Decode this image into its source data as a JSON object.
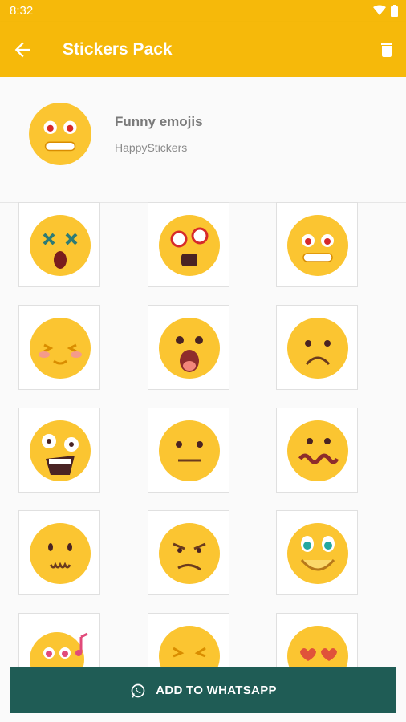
{
  "status": {
    "time": "8:32"
  },
  "appbar": {
    "title": "Stickers Pack"
  },
  "pack": {
    "name": "Funny emojis",
    "publisher": "HappyStickers"
  },
  "action": {
    "label": "ADD TO WHATSAPP"
  },
  "colors": {
    "accent": "#f6b90a",
    "cta": "#1f5c55",
    "emoji": "#fbc531"
  },
  "stickers": [
    "dizzy-face",
    "shocked-face",
    "angry-grimace",
    "blushing-face",
    "open-mouth-face",
    "frown-face",
    "screaming-face",
    "neutral-face",
    "confused-face",
    "cute-face",
    "annoyed-face",
    "big-smile-face",
    "singing-face",
    "frustrated-face",
    "heart-eyes-face"
  ]
}
